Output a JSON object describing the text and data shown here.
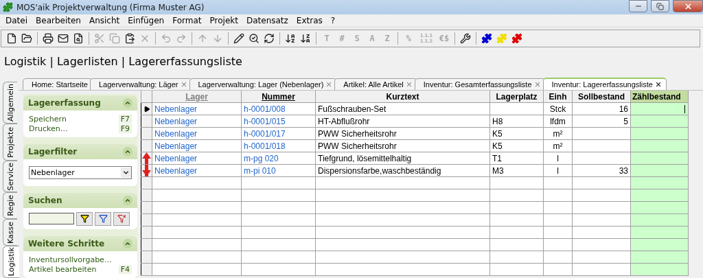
{
  "window": {
    "title": "MOS'aik Projektverwaltung (Firma Muster AG)"
  },
  "menu": [
    "Datei",
    "Bearbeiten",
    "Ansicht",
    "Einfügen",
    "Format",
    "Projekt",
    "Datensatz",
    "Extras",
    "?"
  ],
  "toolbar": [
    [
      {
        "kind": "icon",
        "disabled": false
      },
      {
        "kind": "icon",
        "disabled": false
      }
    ],
    [
      {
        "kind": "icon",
        "disabled": false
      },
      {
        "kind": "icon",
        "disabled": false
      },
      {
        "kind": "icon",
        "disabled": false
      }
    ],
    [
      {
        "kind": "icon",
        "disabled": true
      },
      {
        "kind": "icon",
        "disabled": true
      },
      {
        "kind": "icon",
        "disabled": false
      },
      {
        "kind": "icon",
        "disabled": true
      }
    ],
    [
      {
        "kind": "icon",
        "disabled": true
      },
      {
        "kind": "icon",
        "disabled": true
      }
    ],
    [
      {
        "kind": "icon",
        "disabled": true
      },
      {
        "kind": "icon",
        "disabled": true
      }
    ],
    [
      {
        "kind": "icon",
        "disabled": false
      },
      {
        "kind": "icon",
        "disabled": false
      },
      {
        "kind": "icon",
        "disabled": false
      }
    ],
    [
      {
        "kind": "icon",
        "disabled": false
      },
      {
        "kind": "icon",
        "disabled": false
      }
    ],
    [
      {
        "kind": "glyph",
        "text": "T",
        "disabled": true
      },
      {
        "kind": "glyph",
        "text": "#",
        "disabled": true
      },
      {
        "kind": "glyph",
        "text": "S",
        "disabled": true
      },
      {
        "kind": "glyph",
        "text": "A",
        "disabled": true
      },
      {
        "kind": "glyph",
        "text": "Z",
        "disabled": true
      }
    ],
    [
      {
        "kind": "glyph",
        "text": "%",
        "disabled": true
      },
      {
        "kind": "glyph",
        "text": "1.1.1 1.1.2",
        "disabled": true
      },
      {
        "kind": "glyph",
        "text": "€$",
        "disabled": true
      }
    ],
    [
      {
        "kind": "icon",
        "disabled": false
      }
    ],
    [
      {
        "kind": "puzzle",
        "color": "#0000d0"
      },
      {
        "kind": "puzzle",
        "color": "#f0e000"
      },
      {
        "kind": "puzzle",
        "color": "#e00000"
      }
    ]
  ],
  "breadcrumb": "Logistik | Lagerlisten | Lagererfassungsliste",
  "side_tabs": [
    {
      "label": "Allgemein",
      "selected": false
    },
    {
      "label": "Projekte",
      "selected": false
    },
    {
      "label": "Service",
      "selected": false
    },
    {
      "label": "Regie",
      "selected": false
    },
    {
      "label": "Kasse",
      "selected": false
    },
    {
      "label": "Logistik",
      "selected": true
    }
  ],
  "doc_tabs": [
    {
      "label": "Home: Startseite",
      "closable": false,
      "selected": false
    },
    {
      "label": "Lagerverwaltung: Läger",
      "closable": true,
      "selected": false
    },
    {
      "label": "Lagerverwaltung: Lager (Nebenlager)",
      "closable": true,
      "selected": false
    },
    {
      "label": "Artikel: Alle Artikel",
      "closable": true,
      "selected": false
    },
    {
      "label": "Inventur: Gesamterfassungsliste",
      "closable": true,
      "selected": false
    },
    {
      "label": "Inventur: Lagererfassungsliste",
      "closable": true,
      "selected": true
    }
  ],
  "panel": [
    {
      "title": "Lagererfassung",
      "kind": "actions",
      "items": [
        {
          "label": "Speichern",
          "shortcut": "F7"
        },
        {
          "label": "Drucken…",
          "shortcut": "F9"
        }
      ]
    },
    {
      "title": "Lagerfilter",
      "kind": "select",
      "value": "Nebenlager"
    },
    {
      "title": "Suchen",
      "kind": "search"
    },
    {
      "title": "Weitere Schritte",
      "kind": "actions",
      "items": [
        {
          "label": "Inventursollvorgabe…"
        },
        {
          "label": "Artikel bearbeiten",
          "shortcut": "F4"
        }
      ]
    }
  ],
  "table": {
    "columns": [
      {
        "label": "Lager",
        "kind": "grouped"
      },
      {
        "label": "Nummer",
        "kind": "sorted"
      },
      {
        "label": "Kurztext",
        "kind": "plain"
      },
      {
        "label": "Lagerplatz",
        "kind": "plain"
      },
      {
        "label": "Einh",
        "kind": "plain"
      },
      {
        "label": "Sollbestand",
        "kind": "plain"
      },
      {
        "label": "Zählbestand",
        "kind": "editable"
      }
    ],
    "rows": [
      {
        "current": true,
        "moved": false,
        "cells": [
          "Nebenlager",
          "h-0001/008",
          "Fußschrauben-Set",
          "",
          "Stck",
          "16",
          ""
        ]
      },
      {
        "current": false,
        "moved": false,
        "cells": [
          "Nebenlager",
          "h-0001/015",
          "HT-Abflußrohr",
          "H8",
          "lfdm",
          "5",
          ""
        ]
      },
      {
        "current": false,
        "moved": false,
        "cells": [
          "Nebenlager",
          "h-0001/017",
          "PWW Sicherheitsrohr",
          "K5",
          "m²",
          "",
          ""
        ]
      },
      {
        "current": false,
        "moved": false,
        "cells": [
          "Nebenlager",
          "h-0001/018",
          "PWW Sicherheitsrohr",
          "K5",
          "m²",
          "",
          ""
        ]
      },
      {
        "current": false,
        "moved": true,
        "cells": [
          "Nebenlager",
          "m-pg 020",
          "Tiefgrund, lösemittelhaltig",
          "T1",
          "l",
          "",
          ""
        ]
      },
      {
        "current": false,
        "moved": true,
        "cells": [
          "Nebenlager",
          "m-pi 010",
          "Dispersionsfarbe,waschbeständig",
          "M3",
          "l",
          "33",
          ""
        ]
      }
    ]
  }
}
